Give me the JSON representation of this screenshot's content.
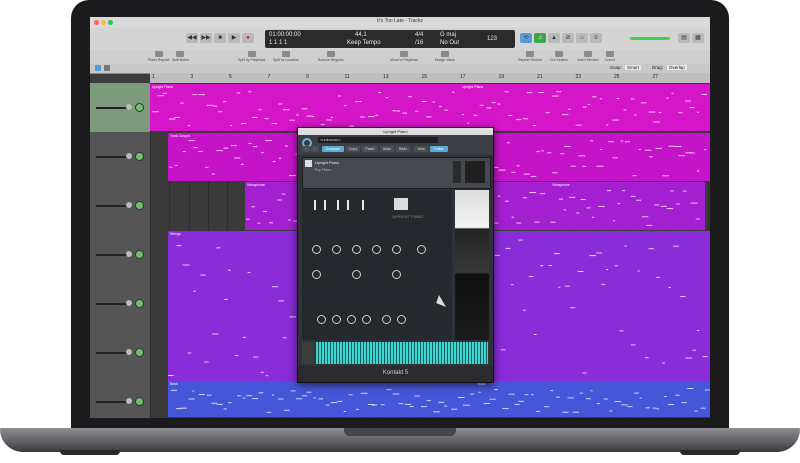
{
  "window": {
    "title": "It's Too Late - Tracks"
  },
  "transport": {
    "position_time": "01:00:00:00",
    "position_bars": "1  1  1  1",
    "tempo": "44,1",
    "tempo_label": "Keep Tempo",
    "signature": "4/4",
    "signature_sub": "/16",
    "key": "G maj",
    "key_sub": "No Out",
    "cpu_label": "123"
  },
  "tools": [
    {
      "label": "Piano Repeat"
    },
    {
      "label": "Split Notes"
    },
    {
      "label": "Split by Playhead"
    },
    {
      "label": "Split by Locators"
    },
    {
      "label": "Bounce Regions"
    },
    {
      "label": "Move to Playhead"
    },
    {
      "label": "Nudge Value"
    },
    {
      "label": "Repeat Section"
    },
    {
      "label": "Cut Section"
    },
    {
      "label": "Insert Section"
    },
    {
      "label": "Colors"
    }
  ],
  "track_header": {
    "snap_label": "Snap:",
    "snap_value": "Smart",
    "drag_label": "Drag:",
    "drag_value": "Overlap"
  },
  "ruler": [
    "1",
    "3",
    "5",
    "7",
    "9",
    "11",
    "13",
    "15",
    "17",
    "19",
    "21",
    "23",
    "25",
    "27"
  ],
  "regions": [
    {
      "name": "Upright Piano",
      "color": "#d516c8"
    },
    {
      "name": "Upright Piano",
      "color": "#d516c8"
    },
    {
      "name": "Tradl Gospel",
      "color": "#c413c8"
    },
    {
      "name": "Vibraphone",
      "color": "#a41fd0"
    },
    {
      "name": "Vibraphone",
      "color": "#a41fd0"
    },
    {
      "name": "Strings",
      "color": "#8a2cd8"
    },
    {
      "name": "Bass",
      "color": "#4656d8"
    },
    {
      "name": "Bass",
      "color": "#4656d8"
    }
  ],
  "kontakt": {
    "title": "Upright Piano",
    "preset": "<unknown>",
    "tabs": [
      "Compare",
      "Copy",
      "Paste",
      "Undo",
      "Redo",
      "View",
      "Editor"
    ],
    "instrument": "Upright Piano",
    "sub": "Pop Piano",
    "brand": "UPRIGHT PIANO",
    "footer": "Kontakt 5"
  }
}
